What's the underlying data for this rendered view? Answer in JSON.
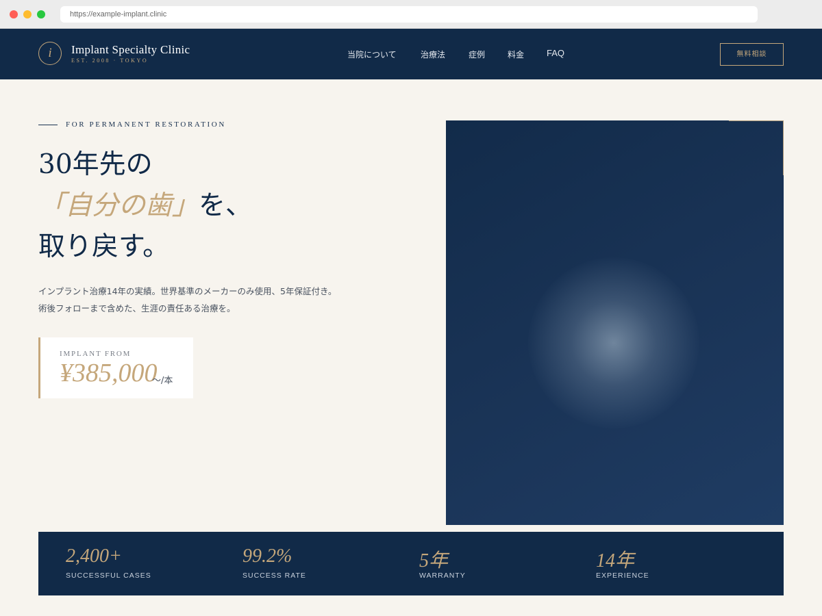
{
  "browser": {
    "url": "https://example-implant.clinic"
  },
  "header": {
    "logo_letter": "i",
    "brand_name": "Implant Specialty Clinic",
    "brand_sub": "EST. 2008 · TOKYO",
    "nav": [
      "当院について",
      "治療法",
      "症例",
      "料金",
      "FAQ"
    ],
    "cta_label": "無料相談"
  },
  "hero": {
    "eyebrow": "FOR PERMANENT RESTORATION",
    "headline_line1": "30年先の",
    "headline_accent": "「自分の歯」",
    "headline_line2_rest": "を、",
    "headline_line3": "取り戻す。",
    "description_line1": "インプラント治療14年の実績。世界基準のメーカーのみ使用、5年保証付き。",
    "description_line2": "術後フォローまで含めた、生涯の責任ある治療を。",
    "price_label": "IMPLANT FROM",
    "price_value": "¥385,000",
    "price_unit": "〜/本"
  },
  "stats": [
    {
      "value": "2,400+",
      "label": "SUCCESSFUL CASES"
    },
    {
      "value": "99.2%",
      "label": "SUCCESS RATE"
    },
    {
      "value": "5年",
      "label": "WARRANTY"
    },
    {
      "value": "14年",
      "label": "EXPERIENCE"
    }
  ],
  "colors": {
    "navy": "#112a48",
    "gold": "#c5a77b",
    "cream": "#f7f4ee"
  }
}
